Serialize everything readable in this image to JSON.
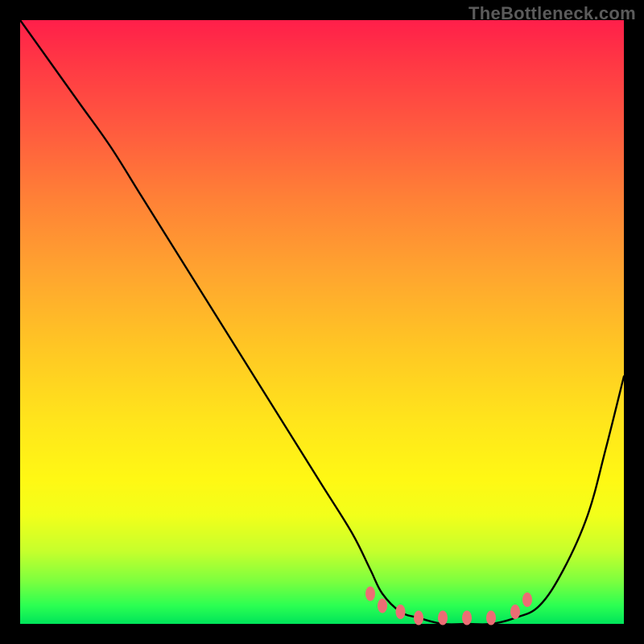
{
  "watermark": "TheBottleneck.com",
  "chart_data": {
    "type": "line",
    "title": "",
    "xlabel": "",
    "ylabel": "",
    "xlim": [
      0,
      100
    ],
    "ylim": [
      0,
      100
    ],
    "series": [
      {
        "name": "bottleneck-curve",
        "x": [
          0,
          5,
          10,
          15,
          20,
          25,
          30,
          35,
          40,
          45,
          50,
          55,
          58,
          60,
          63,
          66,
          70,
          74,
          78,
          82,
          86,
          90,
          94,
          97,
          100
        ],
        "values": [
          100,
          93,
          86,
          79,
          71,
          63,
          55,
          47,
          39,
          31,
          23,
          15,
          9,
          5,
          2,
          1,
          0,
          0,
          0,
          1,
          3,
          9,
          18,
          29,
          41
        ]
      }
    ],
    "markers": {
      "name": "highlight-segment",
      "color": "#ec6d74",
      "x": [
        58,
        60,
        63,
        66,
        70,
        74,
        78,
        82,
        84
      ],
      "values": [
        5,
        3,
        2,
        1,
        1,
        1,
        1,
        2,
        4
      ]
    },
    "gradient_stops": [
      {
        "pos": 0.0,
        "color": "#ff1f4a"
      },
      {
        "pos": 0.5,
        "color": "#ffc624"
      },
      {
        "pos": 0.8,
        "color": "#fff814"
      },
      {
        "pos": 1.0,
        "color": "#00e45a"
      }
    ]
  }
}
